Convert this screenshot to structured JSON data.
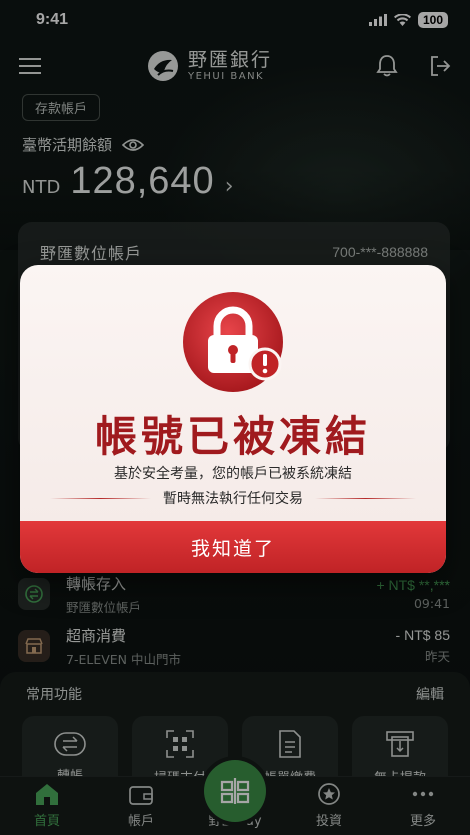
{
  "status": {
    "time": "9:41",
    "battery": "100"
  },
  "header": {
    "bank_name": "野匯銀行",
    "bank_name_en": "YEHUI BANK"
  },
  "account": {
    "chip_label": "存款帳戶",
    "balance_label": "臺幣活期餘額",
    "currency": "NTD",
    "balance": "128,640",
    "card_name": "野匯數位帳戶",
    "card_number": "700-***-888888"
  },
  "transactions": [
    {
      "title": "轉帳存入",
      "sub": "野匯數位帳戶",
      "amount": "+ NT$ **,***",
      "date": "09:41"
    },
    {
      "title": "超商消費",
      "sub": "7-ELEVEN 中山門市",
      "amount": "- NT$ 85",
      "date": "昨天"
    }
  ],
  "favorites": {
    "title": "常用功能",
    "edit": "編輯",
    "items": [
      {
        "label": "轉帳",
        "icon": "transfer-icon"
      },
      {
        "label": "掃碼支付",
        "icon": "qr-scan-icon"
      },
      {
        "label": "帳單繳費",
        "icon": "bill-icon"
      },
      {
        "label": "無卡提款",
        "icon": "atm-icon"
      }
    ]
  },
  "tabs": [
    {
      "label": "首頁",
      "icon": "home-icon",
      "active": true
    },
    {
      "label": "帳戶",
      "icon": "wallet-icon"
    },
    {
      "label": "野匯 Pay",
      "icon": "pay-icon"
    },
    {
      "label": "投資",
      "icon": "invest-icon"
    },
    {
      "label": "更多",
      "icon": "more-icon"
    }
  ],
  "modal": {
    "title": "帳號已被凍結",
    "line1": "基於安全考量，您的帳戶已被系統凍結",
    "line2": "暫時無法執行任何交易",
    "button": "我知道了"
  },
  "colors": {
    "accent_green": "#4cab5d",
    "alert_red": "#c02326",
    "title_red": "#a01a1e"
  }
}
